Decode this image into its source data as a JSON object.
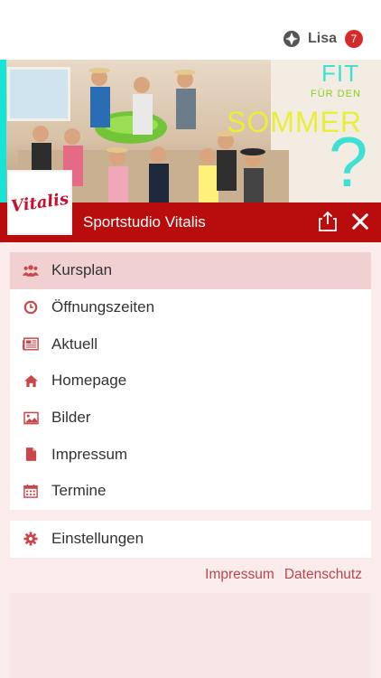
{
  "user": {
    "name": "Lisa",
    "badge": "7"
  },
  "banner": {
    "line1": "FIT",
    "line2": "FÜR DEN",
    "line3": "SOMMER",
    "line4": "?",
    "logo_text": "Vitalis"
  },
  "header": {
    "title": "Sportstudio Vitalis"
  },
  "menu": {
    "items": [
      {
        "label": "Kursplan",
        "icon": "people-icon"
      },
      {
        "label": "Öffnungszeiten",
        "icon": "clock-icon"
      },
      {
        "label": "Aktuell",
        "icon": "newspaper-icon"
      },
      {
        "label": "Homepage",
        "icon": "home-icon"
      },
      {
        "label": "Bilder",
        "icon": "image-icon"
      },
      {
        "label": "Impressum",
        "icon": "document-icon"
      },
      {
        "label": "Termine",
        "icon": "calendar-icon"
      }
    ],
    "settings_label": "Einstellungen"
  },
  "footer": {
    "impressum": "Impressum",
    "datenschutz": "Datenschutz"
  },
  "colors": {
    "brand_red": "#b90d0d",
    "icon_red": "#c9474b",
    "active_bg": "#f0d0d0"
  }
}
